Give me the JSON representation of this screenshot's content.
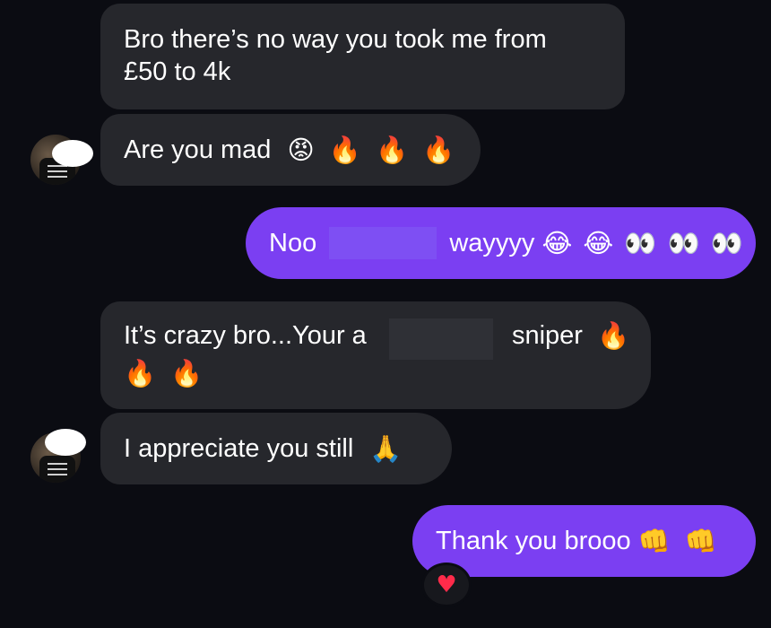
{
  "messages": [
    {
      "id": "m1",
      "direction": "incoming",
      "line1": "Bro there’s no way you took me from",
      "line2": "£50 to 4k"
    },
    {
      "id": "m2",
      "direction": "incoming",
      "text": "Are you mad",
      "emojis": [
        "😡",
        "🔥",
        "🔥",
        "🔥"
      ]
    },
    {
      "id": "m3",
      "direction": "outgoing",
      "text_start": "Noo",
      "text_end": "wayyyy",
      "emojis": [
        "😂",
        "😂",
        "👀",
        "👀",
        "👀"
      ]
    },
    {
      "id": "m4",
      "direction": "incoming",
      "text_start": "It’s crazy bro...Your a",
      "text_end": "sniper",
      "emojis_line1": [
        "🔥"
      ],
      "emojis_line2": [
        "🔥",
        "🔥"
      ]
    },
    {
      "id": "m5",
      "direction": "incoming",
      "text": "I appreciate you still",
      "emojis": [
        "🙏"
      ]
    },
    {
      "id": "m6",
      "direction": "outgoing",
      "text": "Thank you brooo",
      "emojis": [
        "👊",
        "👊"
      ],
      "reaction": "♥"
    }
  ],
  "colors": {
    "background": "#0b0c12",
    "incoming_bubble": "#26272c",
    "outgoing_bubble": "#7b3ff2",
    "text": "#ffffff",
    "reaction_heart": "#ff2b4a"
  }
}
